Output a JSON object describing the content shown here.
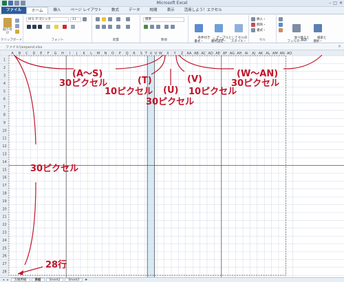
{
  "window": {
    "title": "Microsoft Excel",
    "buttons": [
      "–",
      "□",
      "✕"
    ]
  },
  "ribbon_tabs": [
    "ファイル",
    "ホーム",
    "挿入",
    "ページ レイアウト",
    "数式",
    "データ",
    "校閲",
    "表示",
    "活用しよう！エクセル"
  ],
  "ribbon": {
    "paste_label": "貼り付け",
    "clipboard_group": "クリップボード",
    "font_name": "ＭＳ Ｐゴシック",
    "font_size": "11",
    "font_group": "フォント",
    "alignment_group": "配置",
    "number_format": "標準",
    "number_group": "数値",
    "cond_format_label": "条件付き\n書式・",
    "table_format_label": "テーブルとして\n書式設定・",
    "cell_style_label": "セルの\nスタイル・",
    "style_group": "スタイル",
    "insert_label": "挿入・",
    "delete_label": "削除・",
    "format_label": "書式・",
    "cells_group": "セル",
    "sort_label": "並べ替えと\nフィルター・",
    "find_label": "検索と\n選択・",
    "edit_group": "編集"
  },
  "file_path": "ファイル\\\\expand.xlsx",
  "grid": {
    "columns": [
      "A",
      "B",
      "C",
      "D",
      "E",
      "F",
      "G",
      "H",
      "I",
      "J",
      "K",
      "L",
      "M",
      "N",
      "O",
      "P",
      "Q",
      "R",
      "S",
      "T",
      "U",
      "V",
      "W",
      "X",
      "Y",
      "Z",
      "AA",
      "AB",
      "AC",
      "AD",
      "AE",
      "AF",
      "AG",
      "AH",
      "AI",
      "AJ",
      "AK",
      "AL",
      "AM",
      "AN",
      "AO"
    ],
    "rows": 28,
    "highlight_column": "U",
    "highlight_color": "#d6e9f5",
    "gridline_color": "#d0d7e5",
    "thick_line_color": "#555555"
  },
  "annotations": {
    "range_as": "(A～S)",
    "px_as": "30ピクセル",
    "range_t": "(T)",
    "px_t": "10ピクセル",
    "range_u": "(U)",
    "px_u": "30ピクセル",
    "range_v": "(V)",
    "px_v": "10ピクセル",
    "range_wan": "(W～AN)",
    "px_wan": "30ピクセル",
    "px_rows": "30ピクセル",
    "rows_count": "28行",
    "color": "#c0142a"
  },
  "sheet_tabs": [
    "方眼用紙",
    "表紙",
    "Sheet2",
    "Sheet3"
  ],
  "active_sheet": "表紙"
}
